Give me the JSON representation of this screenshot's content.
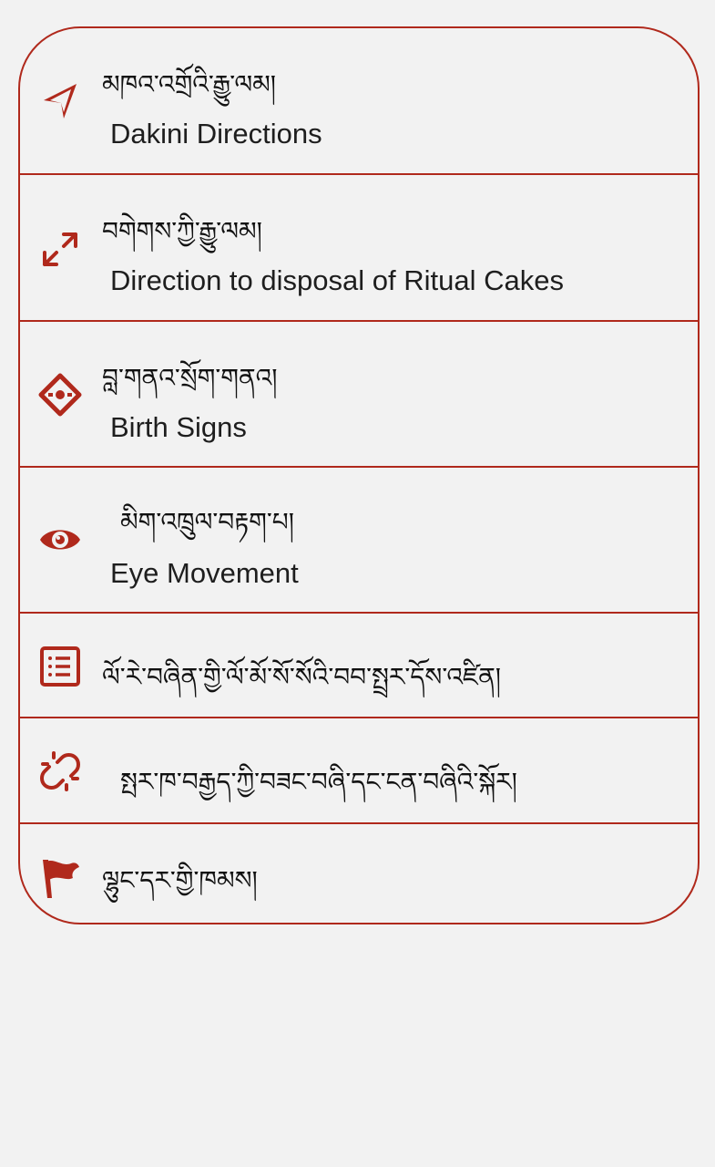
{
  "accent_color": "#b0291c",
  "menu": {
    "items": [
      {
        "icon": "navigation-arrow-icon",
        "tibetan": "མཁའ་འགྲོའི་རྒྱུ་ལམ།",
        "english": "Dakini Directions"
      },
      {
        "icon": "expand-arrows-icon",
        "tibetan": "བགེགས་ཀྱི་རྒྱུ་ལམ།",
        "english": "Direction to disposal of Ritual Cakes"
      },
      {
        "icon": "diamond-target-icon",
        "tibetan": "བླ་གནའ་སྲོག་གནའ།",
        "english": "Birth Signs"
      },
      {
        "icon": "eye-icon",
        "tibetan": "མིག་འཁྲུལ་བརྟག་པ།",
        "english": "Eye Movement"
      },
      {
        "icon": "list-document-icon",
        "tibetan": "ལོ་རེ་བཞིན་གྱི་ལོ་མོ་སོ་སོའི་བབ་སྤྲར་དོས་འཛིན།",
        "english": ""
      },
      {
        "icon": "broken-link-icon",
        "tibetan": "སྤར་ཁ་བརྒྱད་ཀྱི་བཟང་བཞི་དང་ངན་བཞིའི་སྐོར།",
        "english": ""
      },
      {
        "icon": "flag-icon",
        "tibetan": "ལྷུང་དར་གྱི་ཁམས།",
        "english": ""
      }
    ]
  }
}
